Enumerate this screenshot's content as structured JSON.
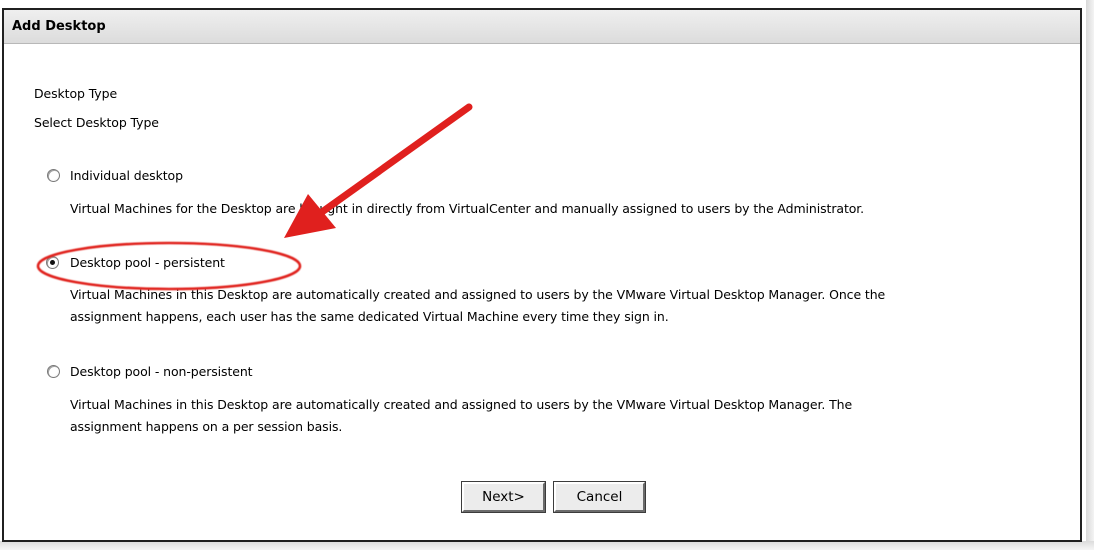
{
  "dialog": {
    "title": "Add Desktop",
    "section_heading": "Desktop Type",
    "section_subheading": "Select Desktop Type"
  },
  "options": [
    {
      "label": "Individual desktop",
      "selected": false,
      "description": [
        "Virtual Machines for the Desktop are brought in directly from VirtualCenter and manually assigned to users by the Administrator."
      ]
    },
    {
      "label": "Desktop pool - persistent",
      "selected": true,
      "description": [
        "Virtual Machines in this Desktop are automatically created and assigned to users by the VMware Virtual Desktop Manager. Once the",
        "assignment happens, each user has the same dedicated Virtual Machine every time they sign in."
      ]
    },
    {
      "label": "Desktop pool - non-persistent",
      "selected": false,
      "description": [
        "Virtual Machines in this Desktop are automatically created and assigned to users by the VMware Virtual Desktop Manager. The",
        "assignment happens on a per session basis."
      ]
    }
  ],
  "buttons": {
    "next_label": "Next>",
    "cancel_label": "Cancel"
  },
  "annotation": {
    "color": "#e0201e"
  }
}
